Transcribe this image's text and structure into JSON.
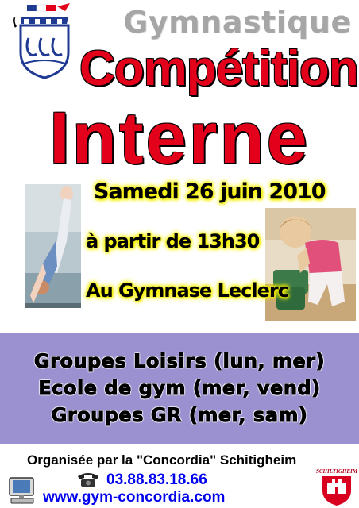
{
  "header": {
    "category": "Gymnastique",
    "title_line1": "Compétition",
    "title_line2": "Interne"
  },
  "event": {
    "date": "Samedi 26 juin 2010",
    "time": "à partir de 13h30",
    "place": "Au Gymnase Leclerc"
  },
  "groups": [
    "Groupes Loisirs (lun, mer)",
    "Ecole de gym (mer, vend)",
    "Groupes GR (mer, sam)"
  ],
  "footer": {
    "organizer": "Organisée par la \"Concordia\" Schitigheim",
    "phone": "03.88.83.18.66",
    "website": "www.gym-concordia.com",
    "city_logo_text": "SCHILTIGHEIM"
  },
  "icons": {
    "club_logo": "club-crest-icon",
    "phone": "telephone-icon",
    "computer": "computer-icon",
    "city": "city-crest-icon"
  },
  "colors": {
    "title_red": "#e3001b",
    "band_purple": "#9c91d0",
    "highlight_yellow": "#f5f000",
    "link_blue": "#0000ee",
    "category_gray": "#a6a6a6"
  }
}
